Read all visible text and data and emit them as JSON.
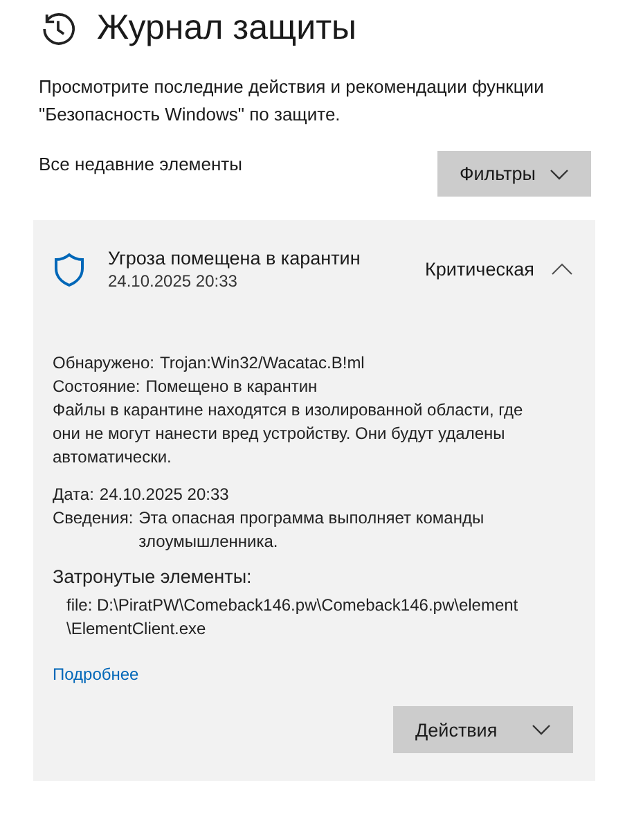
{
  "page": {
    "title": "Журнал защиты",
    "description": "Просмотрите последние действия и рекомендации функции \"Безопасность Windows\" по защите."
  },
  "filter": {
    "label": "Все недавние элементы",
    "button": "Фильтры"
  },
  "event": {
    "title": "Угроза помещена в карантин",
    "time": "24.10.2025 20:33",
    "severity": "Критическая",
    "expanded": true,
    "details": [
      {
        "label": "Обнаружено:",
        "value": "Trojan:Win32/Wacatac.B!ml"
      },
      {
        "label": "Состояние:",
        "value": "Помещено в карантин"
      }
    ],
    "note": "Файлы в карантине находятся в изолированной области, где они не могут нанести вред устройству. Они будут удалены автоматически.",
    "info": [
      {
        "label": "Дата:",
        "value": "24.10.2025 20:33"
      },
      {
        "label": "Сведения:",
        "value": "Эта опасная программа выполняет команды злоумышленника."
      }
    ],
    "affected_title": "Затронутые элементы:",
    "affected_lines": [
      "file: D:\\PiratPW\\Comeback146.pw\\Comeback146.pw\\element",
      "\\ElementClient.exe"
    ],
    "link": "Подробнее",
    "actions": "Действия"
  }
}
